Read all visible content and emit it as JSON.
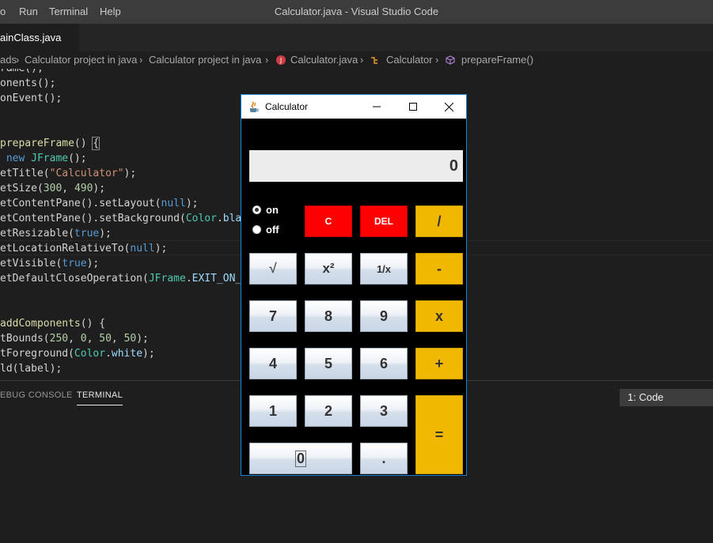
{
  "menu": [
    "o",
    "Run",
    "Terminal",
    "Help"
  ],
  "window_title": "Calculator.java - Visual Studio Code",
  "tab": {
    "label": "ainClass.java"
  },
  "breadcrumb": {
    "items": [
      "ads",
      "Calculator project in java",
      "Calculator project in java",
      "Calculator.java",
      "Calculator",
      "prepareFrame()"
    ]
  },
  "code": {
    "lines": [
      "rame();",
      "onents();",
      "onEvent();",
      "",
      "",
      "prepareFrame() {",
      " new JFrame();",
      "etTitle(\"Calculator\");",
      "etSize(300, 490);",
      "etContentPane().setLayout(null);",
      "etContentPane().setBackground(Color.black",
      "etResizable(true);",
      "etLocationRelativeTo(null);",
      "etVisible(true);",
      "etDefaultCloseOperation(JFrame.EXIT_ON_C",
      "",
      "",
      "addComponents() {",
      "tBounds(250, 0, 50, 50);",
      "tForeground(Color.white);",
      "ld(label);"
    ]
  },
  "panel": {
    "tabs": [
      "EBUG CONSOLE",
      "TERMINAL"
    ],
    "active_tab": "TERMINAL",
    "terminal_select": "1: Code"
  },
  "calculator": {
    "title": "Calculator",
    "display": "0",
    "radio": {
      "on_label": "on",
      "off_label": "off",
      "selected": "on"
    },
    "buttons": {
      "clear": "C",
      "del": "DEL",
      "divide": "/",
      "sqrt": "√",
      "square": "x²",
      "reciprocal": "1/x",
      "minus": "-",
      "seven": "7",
      "eight": "8",
      "nine": "9",
      "multiply": "x",
      "four": "4",
      "five": "5",
      "six": "6",
      "plus": "+",
      "one": "1",
      "two": "2",
      "three": "3",
      "equals": "=",
      "zero": "0",
      "dot": "."
    }
  },
  "colors": {
    "editor_bg": "#1e1e1e",
    "titlebar_bg": "#3c3c3c",
    "calc_red": "#ff0000",
    "calc_yellow": "#f0b800",
    "window_border": "#1883d7"
  }
}
